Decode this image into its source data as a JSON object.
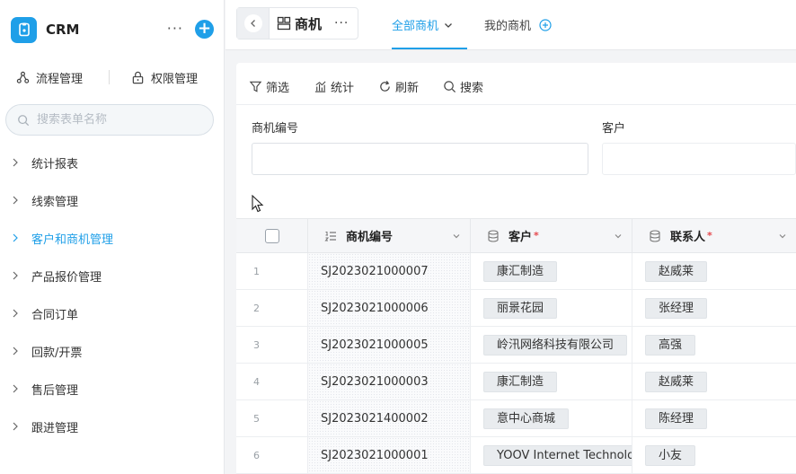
{
  "app": {
    "name": "CRM",
    "more": "···",
    "add": "+"
  },
  "mgmt": {
    "flow": "流程管理",
    "perm": "权限管理"
  },
  "sidebar_search": {
    "placeholder": "搜索表单名称"
  },
  "nav": [
    {
      "label": "统计报表",
      "active": false
    },
    {
      "label": "线索管理",
      "active": false
    },
    {
      "label": "客户和商机管理",
      "active": true
    },
    {
      "label": "产品报价管理",
      "active": false
    },
    {
      "label": "合同订单",
      "active": false
    },
    {
      "label": "回款/开票",
      "active": false
    },
    {
      "label": "售后管理",
      "active": false
    },
    {
      "label": "跟进管理",
      "active": false
    }
  ],
  "header": {
    "title": "商机",
    "more": "···"
  },
  "tabs": [
    {
      "label": "全部商机",
      "active": true
    },
    {
      "label": "我的商机",
      "active": false
    }
  ],
  "toolbar": {
    "filter": "筛选",
    "stats": "统计",
    "refresh": "刷新",
    "search": "搜索"
  },
  "filters": {
    "code_label": "商机编号",
    "customer_label": "客户"
  },
  "table": {
    "columns": {
      "code": "商机编号",
      "customer": "客户",
      "contact": "联系人",
      "required_mark": "*"
    },
    "rows": [
      {
        "index": "1",
        "code": "SJ2023021000007",
        "customer": "康汇制造",
        "contact": "赵威莱"
      },
      {
        "index": "2",
        "code": "SJ2023021000006",
        "customer": "丽景花园",
        "contact": "张经理"
      },
      {
        "index": "3",
        "code": "SJ2023021000005",
        "customer": "岭汛网络科技有限公司",
        "contact": "高强"
      },
      {
        "index": "4",
        "code": "SJ2023021000003",
        "customer": "康汇制造",
        "contact": "赵威莱"
      },
      {
        "index": "5",
        "code": "SJ2023021400002",
        "customer": "意中心商城",
        "contact": "陈经理"
      },
      {
        "index": "6",
        "code": "SJ2023021000001",
        "customer": "YOOV Internet Technolo",
        "contact": "小友"
      }
    ]
  },
  "colors": {
    "accent": "#1f9fe8",
    "required": "#e5484d"
  }
}
